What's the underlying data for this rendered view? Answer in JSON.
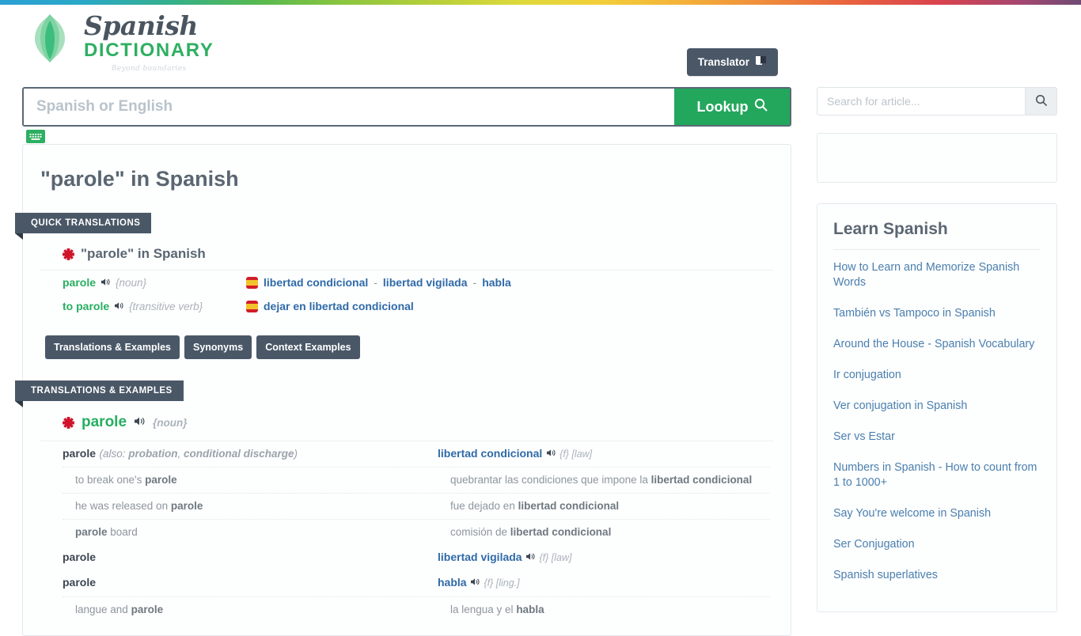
{
  "header": {
    "logo_script": "Spanish",
    "logo_dictionary": "DICTIONARY",
    "logo_tagline": "Beyond boundaries",
    "translator_label": "Translator"
  },
  "search": {
    "placeholder": "Spanish or English",
    "value": "",
    "lookup_label": "Lookup"
  },
  "sidebar": {
    "article_search_placeholder": "Search for article...",
    "article_search_value": "",
    "learn_title": "Learn Spanish",
    "links": [
      "How to Learn and Memorize Spanish Words",
      "También vs Tampoco in Spanish",
      "Around the House - Spanish Vocabulary",
      "Ir conjugation",
      "Ver conjugation in Spanish",
      "Ser vs Estar",
      "Numbers in Spanish - How to count from 1 to 1000+",
      "Say You're welcome in Spanish",
      "Ser Conjugation",
      "Spanish superlatives"
    ]
  },
  "main": {
    "page_title": "\"parole\" in Spanish",
    "quick_ribbon": "QUICK TRANSLATIONS",
    "quick_heading": "\"parole\" in Spanish",
    "quick_rows": [
      {
        "term": "parole",
        "pos": "{noun}",
        "translations": [
          "libertad condicional",
          "libertad vigilada",
          "habla"
        ]
      },
      {
        "term": "to parole",
        "pos": "{transitive verb}",
        "translations": [
          "dejar en libertad condicional"
        ]
      }
    ],
    "tabs": [
      "Translations & Examples",
      "Synonyms",
      "Context Examples"
    ],
    "te_ribbon": "TRANSLATIONS & EXAMPLES",
    "te_heading_word": "parole",
    "te_heading_pos": "{noun}",
    "entries": [
      {
        "en": "parole",
        "en_also": "(also: probation, conditional discharge)",
        "es": "libertad condicional",
        "es_meta": "{f} [law]",
        "examples": [
          {
            "en": "to break one's parole",
            "en_bold": "parole",
            "es": "quebrantar las condiciones que impone la libertad condicional",
            "es_bold": "libertad condicional"
          },
          {
            "en": "he was released on parole",
            "en_bold": "parole",
            "es": "fue dejado en libertad condicional",
            "es_bold": "libertad condicional"
          },
          {
            "en": "parole board",
            "en_bold": "parole",
            "es": "comisión de libertad condicional",
            "es_bold": "libertad condicional"
          }
        ]
      },
      {
        "en": "parole",
        "en_also": "",
        "es": "libertad vigilada",
        "es_meta": "{f} [law]",
        "examples": []
      },
      {
        "en": "parole",
        "en_also": "",
        "es": "habla",
        "es_meta": "{f} [ling.]",
        "examples": [
          {
            "en": "langue and parole",
            "en_bold": "parole",
            "es": "la lengua y el habla",
            "es_bold": "habla"
          }
        ]
      }
    ]
  },
  "colors": {
    "accent_green": "#22a75c",
    "slate": "#4a5767",
    "link_blue": "#2f6aa8",
    "term_green": "#27ae60"
  }
}
